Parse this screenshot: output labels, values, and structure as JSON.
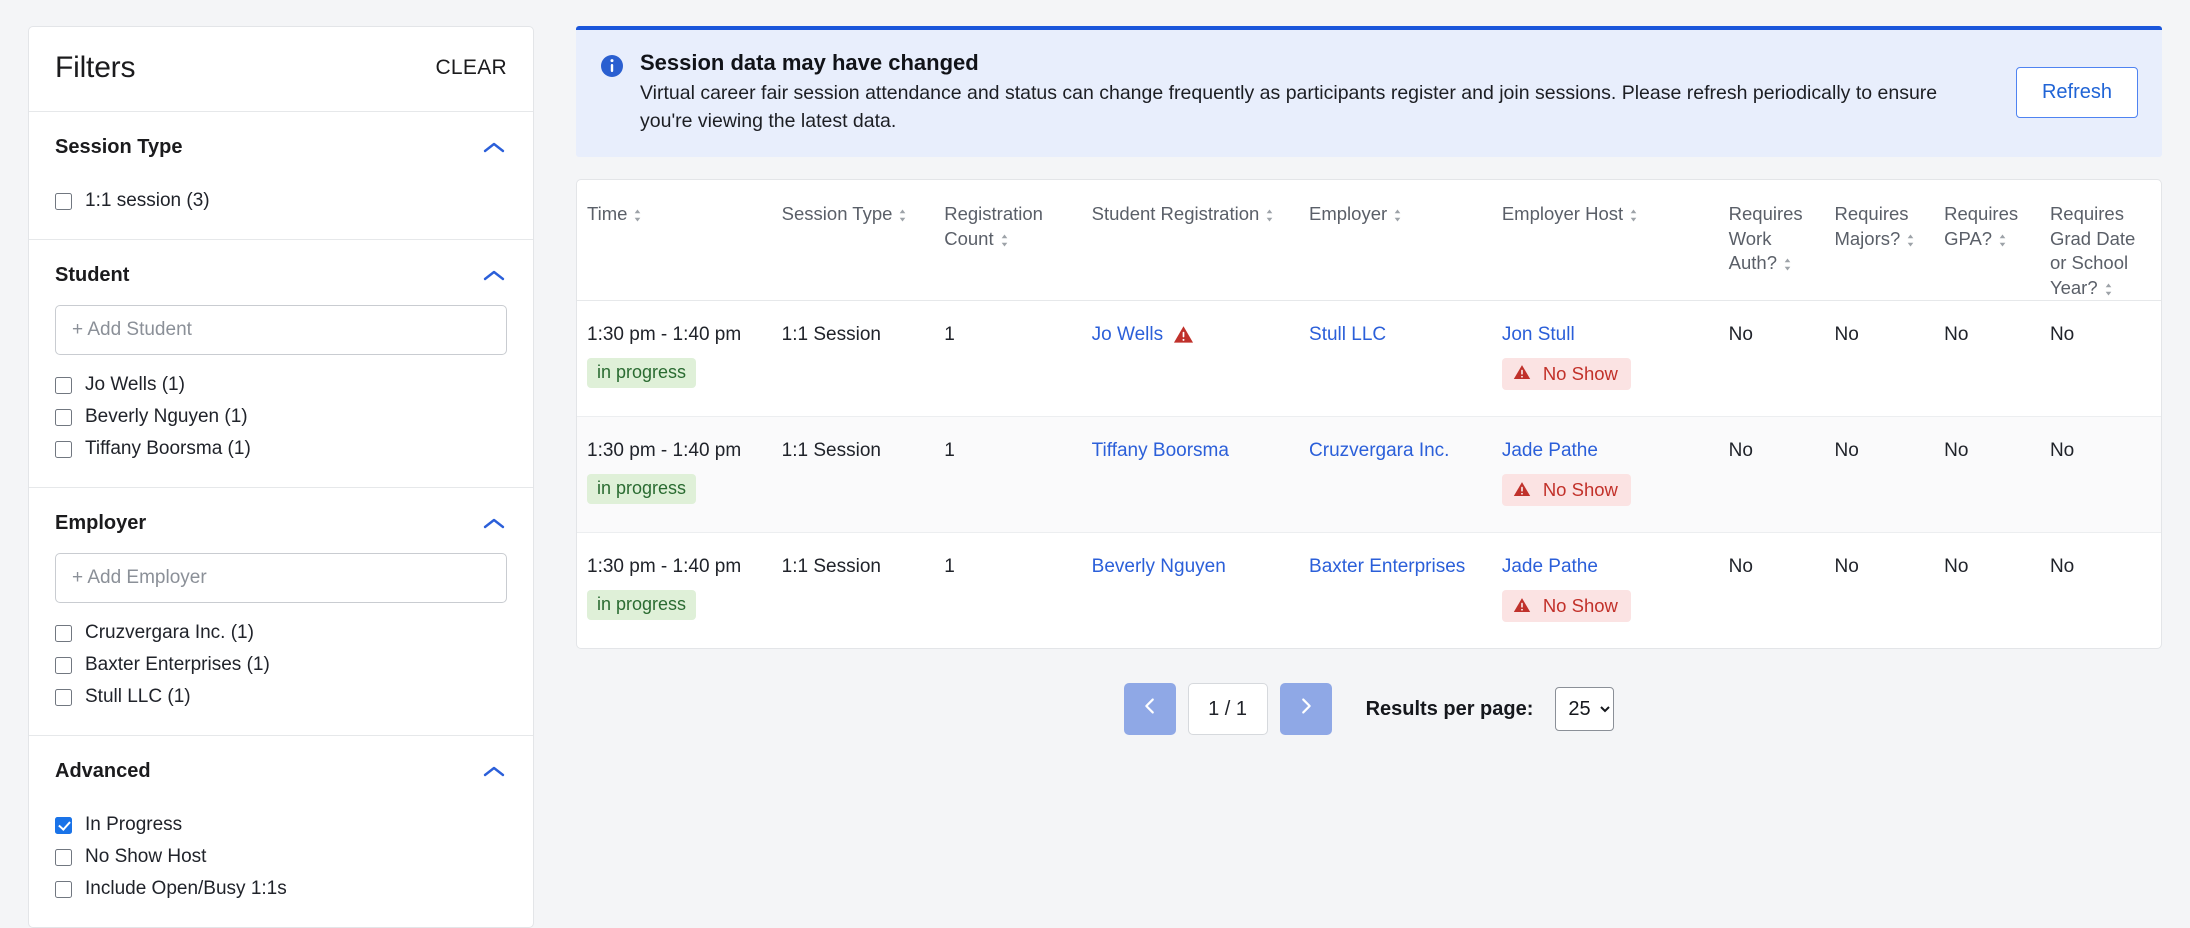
{
  "sidebar": {
    "title": "Filters",
    "clear_label": "CLEAR",
    "groups": [
      {
        "title": "Session Type",
        "collapse_icon": "chevron-up-icon",
        "input": null,
        "options": [
          {
            "label": "1:1 session (3)",
            "checked": false
          }
        ]
      },
      {
        "title": "Student",
        "collapse_icon": "chevron-up-icon",
        "input": {
          "value": "",
          "placeholder": "+ Add Student"
        },
        "options": [
          {
            "label": "Jo Wells (1)",
            "checked": false
          },
          {
            "label": "Beverly Nguyen (1)",
            "checked": false
          },
          {
            "label": "Tiffany Boorsma (1)",
            "checked": false
          }
        ]
      },
      {
        "title": "Employer",
        "collapse_icon": "chevron-up-icon",
        "input": {
          "value": "",
          "placeholder": "+ Add Employer"
        },
        "options": [
          {
            "label": "Cruzvergara Inc. (1)",
            "checked": false
          },
          {
            "label": "Baxter Enterprises (1)",
            "checked": false
          },
          {
            "label": "Stull LLC (1)",
            "checked": false
          }
        ]
      },
      {
        "title": "Advanced",
        "collapse_icon": "chevron-up-icon",
        "input": null,
        "options": [
          {
            "label": "In Progress",
            "checked": true
          },
          {
            "label": "No Show Host",
            "checked": false
          },
          {
            "label": "Include Open/Busy 1:1s",
            "checked": false
          }
        ]
      }
    ]
  },
  "banner": {
    "icon": "info-circle-icon",
    "title": "Session data may have changed",
    "body": "Virtual career fair session attendance and status can change frequently as participants register and join sessions. Please refresh periodically to ensure you're viewing the latest data.",
    "refresh_label": "Refresh",
    "accent_color": "#1a56db",
    "background_color": "#e8eefc"
  },
  "table": {
    "columns": [
      {
        "label": "Time",
        "sortable": true
      },
      {
        "label": "Session Type",
        "sortable": true
      },
      {
        "label": "Registration Count",
        "sortable": true
      },
      {
        "label": "Student Registration",
        "sortable": true
      },
      {
        "label": "Employer",
        "sortable": true
      },
      {
        "label": "Employer Host",
        "sortable": true
      },
      {
        "label": "Requires Work Auth?",
        "sortable": true
      },
      {
        "label": "Requires Majors?",
        "sortable": true
      },
      {
        "label": "Requires GPA?",
        "sortable": true
      },
      {
        "label": "Requires Grad Date or School Year?",
        "sortable": true
      }
    ],
    "rows": [
      {
        "time": "1:30 pm - 1:40 pm",
        "time_badge": "in progress",
        "session_type": "1:1 Session",
        "registration_count": "1",
        "student": "Jo Wells",
        "student_warning": true,
        "employer": "Stull LLC",
        "employer_host": "Jon Stull",
        "host_badge": "No Show",
        "requires_work_auth": "No",
        "requires_majors": "No",
        "requires_gpa": "No",
        "requires_grad_date": "No"
      },
      {
        "time": "1:30 pm - 1:40 pm",
        "time_badge": "in progress",
        "session_type": "1:1 Session",
        "registration_count": "1",
        "student": "Tiffany Boorsma",
        "student_warning": false,
        "employer": "Cruzvergara Inc.",
        "employer_host": "Jade Pathe",
        "host_badge": "No Show",
        "requires_work_auth": "No",
        "requires_majors": "No",
        "requires_gpa": "No",
        "requires_grad_date": "No"
      },
      {
        "time": "1:30 pm - 1:40 pm",
        "time_badge": "in progress",
        "session_type": "1:1 Session",
        "registration_count": "1",
        "student": "Beverly Nguyen",
        "student_warning": false,
        "employer": "Baxter Enterprises",
        "employer_host": "Jade Pathe",
        "host_badge": "No Show",
        "requires_work_auth": "No",
        "requires_majors": "No",
        "requires_gpa": "No",
        "requires_grad_date": "No"
      }
    ]
  },
  "pagination": {
    "prev_icon": "chevron-left-icon",
    "next_icon": "chevron-right-icon",
    "page_indicator": "1 / 1",
    "results_per_page_label": "Results per page:",
    "results_per_page_value": "25",
    "results_per_page_options": [
      "25"
    ]
  },
  "colors": {
    "link": "#2b5fd9",
    "accent": "#1a56db",
    "badge_progress_bg": "#dff0d8",
    "badge_progress_text": "#2a6b31",
    "badge_noshow_bg": "#fbe3e3",
    "badge_noshow_text": "#c2312a"
  }
}
